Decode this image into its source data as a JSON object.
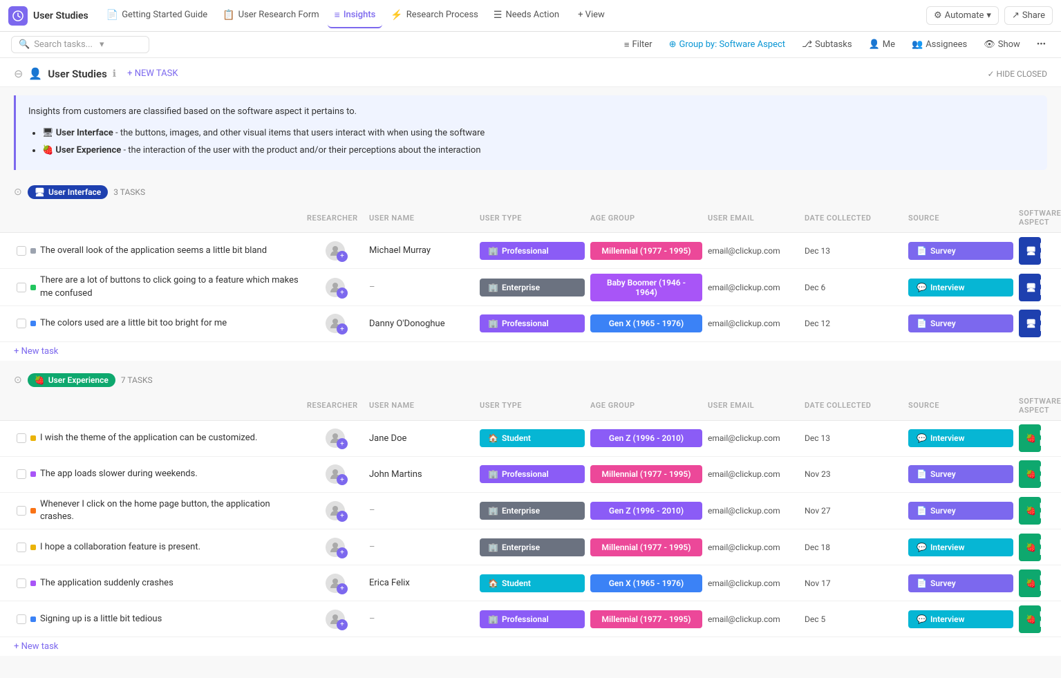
{
  "nav": {
    "logo_icon": "⚙",
    "project_title": "User Studies",
    "tabs": [
      {
        "id": "getting-started",
        "label": "Getting Started Guide",
        "icon": "📄",
        "active": false
      },
      {
        "id": "user-research-form",
        "label": "User Research Form",
        "icon": "📋",
        "active": false
      },
      {
        "id": "insights",
        "label": "Insights",
        "icon": "≡",
        "active": true
      },
      {
        "id": "research-process",
        "label": "Research Process",
        "icon": "⚡",
        "active": false
      },
      {
        "id": "needs-action",
        "label": "Needs Action",
        "icon": "☰",
        "active": false
      },
      {
        "id": "view",
        "label": "+ View",
        "icon": "",
        "active": false
      }
    ],
    "automate_label": "Automate",
    "share_label": "Share"
  },
  "toolbar": {
    "search_placeholder": "Search tasks...",
    "filter_label": "Filter",
    "group_by_label": "Group by: Software Aspect",
    "subtasks_label": "Subtasks",
    "me_label": "Me",
    "assignees_label": "Assignees",
    "show_label": "Show"
  },
  "page": {
    "title": "User Studies",
    "new_task_label": "+ NEW TASK",
    "hide_closed_label": "✓ HIDE CLOSED",
    "description": "Insights from customers are classified based on the software aspect it pertains to.",
    "list_items": [
      {
        "icon": "🖥",
        "title": "User Interface",
        "text": " - the buttons, images, and other visual items that users interact with when using the software"
      },
      {
        "icon": "🍓",
        "title": "User Experience",
        "text": " - the interaction of the user with the product and/or their perceptions about the interaction"
      }
    ]
  },
  "column_headers": [
    "",
    "RESEARCHER",
    "USER NAME",
    "USER TYPE",
    "AGE GROUP",
    "USER EMAIL",
    "DATE COLLECTED",
    "SOURCE",
    "SOFTWARE ASPECT"
  ],
  "groups": [
    {
      "id": "ui",
      "label": "User Interface",
      "label_class": "ui",
      "icon": "🖥",
      "task_count": "3 TASKS",
      "tasks": [
        {
          "text": "The overall look of the application seems a little bit bland",
          "priority_color": "#9ca3af",
          "researcher": true,
          "username": "Michael Murray",
          "user_type": "Professional",
          "user_type_class": "badge-professional",
          "user_type_icon": "🏢",
          "age_group": "Millennial (1977 - 1995)",
          "age_class": "age-millennial",
          "email": "email@clickup.com",
          "date": "Dec 13",
          "source": "Survey",
          "source_class": "source-survey",
          "source_icon": "📄",
          "aspect": "User Interface",
          "aspect_class": "aspect-ui",
          "aspect_icon": "🖥"
        },
        {
          "text": "There are a lot of buttons to click going to a feature which makes me confused",
          "priority_color": "#22c55e",
          "researcher": true,
          "username": "–",
          "user_type": "Enterprise",
          "user_type_class": "badge-enterprise",
          "user_type_icon": "🏢",
          "age_group": "Baby Boomer (1946 - 1964)",
          "age_class": "age-boomer",
          "email": "email@clickup.com",
          "date": "Dec 6",
          "source": "Interview",
          "source_class": "source-interview",
          "source_icon": "💬",
          "aspect": "User Interface",
          "aspect_class": "aspect-ui",
          "aspect_icon": "🖥"
        },
        {
          "text": "The colors used are a little bit too bright for me",
          "priority_color": "#3b82f6",
          "researcher": true,
          "username": "Danny O'Donoghue",
          "user_type": "Professional",
          "user_type_class": "badge-professional",
          "user_type_icon": "🏢",
          "age_group": "Gen X (1965 - 1976)",
          "age_class": "age-genx",
          "email": "email@clickup.com",
          "date": "Dec 12",
          "source": "Survey",
          "source_class": "source-survey",
          "source_icon": "📄",
          "aspect": "User Interface",
          "aspect_class": "aspect-ui",
          "aspect_icon": "🖥"
        }
      ],
      "new_task_label": "+ New task"
    },
    {
      "id": "ux",
      "label": "User Experience",
      "label_class": "ux",
      "icon": "🍓",
      "task_count": "7 TASKS",
      "tasks": [
        {
          "text": "I wish the theme of the application can be customized.",
          "priority_color": "#eab308",
          "researcher": true,
          "username": "Jane Doe",
          "user_type": "Student",
          "user_type_class": "badge-student",
          "user_type_icon": "🏠",
          "age_group": "Gen Z (1996 - 2010)",
          "age_class": "age-genz",
          "email": "email@clickup.com",
          "date": "Dec 13",
          "source": "Interview",
          "source_class": "source-interview",
          "source_icon": "💬",
          "aspect": "User Experience",
          "aspect_class": "aspect-ux",
          "aspect_icon": "🍓"
        },
        {
          "text": "The app loads slower during weekends.",
          "priority_color": "#a855f7",
          "researcher": true,
          "username": "John Martins",
          "user_type": "Professional",
          "user_type_class": "badge-professional",
          "user_type_icon": "🏢",
          "age_group": "Millennial (1977 - 1995)",
          "age_class": "age-millennial",
          "email": "email@clickup.com",
          "date": "Nov 23",
          "source": "Survey",
          "source_class": "source-survey",
          "source_icon": "📄",
          "aspect": "User Experience",
          "aspect_class": "aspect-ux",
          "aspect_icon": "🍓"
        },
        {
          "text": "Whenever I click on the home page button, the application crashes.",
          "priority_color": "#f97316",
          "researcher": true,
          "username": "–",
          "user_type": "Enterprise",
          "user_type_class": "badge-enterprise",
          "user_type_icon": "🏢",
          "age_group": "Gen Z (1996 - 2010)",
          "age_class": "age-genz",
          "email": "email@clickup.com",
          "date": "Nov 27",
          "source": "Survey",
          "source_class": "source-survey",
          "source_icon": "📄",
          "aspect": "User Experience",
          "aspect_class": "aspect-ux",
          "aspect_icon": "🍓"
        },
        {
          "text": "I hope a collaboration feature is present.",
          "priority_color": "#eab308",
          "researcher": true,
          "username": "–",
          "user_type": "Enterprise",
          "user_type_class": "badge-enterprise",
          "user_type_icon": "🏢",
          "age_group": "Millennial (1977 - 1995)",
          "age_class": "age-millennial",
          "email": "email@clickup.com",
          "date": "Dec 18",
          "source": "Interview",
          "source_class": "source-interview",
          "source_icon": "💬",
          "aspect": "User Experience",
          "aspect_class": "aspect-ux",
          "aspect_icon": "🍓"
        },
        {
          "text": "The application suddenly crashes",
          "priority_color": "#a855f7",
          "researcher": true,
          "username": "Erica Felix",
          "user_type": "Student",
          "user_type_class": "badge-student",
          "user_type_icon": "🏠",
          "age_group": "Gen X (1965 - 1976)",
          "age_class": "age-genx",
          "email": "email@clickup.com",
          "date": "Nov 17",
          "source": "Survey",
          "source_class": "source-survey",
          "source_icon": "📄",
          "aspect": "User Experience",
          "aspect_class": "aspect-ux",
          "aspect_icon": "🍓"
        },
        {
          "text": "Signing up is a little bit tedious",
          "priority_color": "#3b82f6",
          "researcher": true,
          "username": "–",
          "user_type": "Professional",
          "user_type_class": "badge-professional",
          "user_type_icon": "🏢",
          "age_group": "Millennial (1977 - 1995)",
          "age_class": "age-millennial",
          "email": "email@clickup.com",
          "date": "Dec 5",
          "source": "Interview",
          "source_class": "source-interview",
          "source_icon": "💬",
          "aspect": "User Experience",
          "aspect_class": "aspect-ux",
          "aspect_icon": "🍓"
        }
      ],
      "new_task_label": "+ New task"
    }
  ]
}
